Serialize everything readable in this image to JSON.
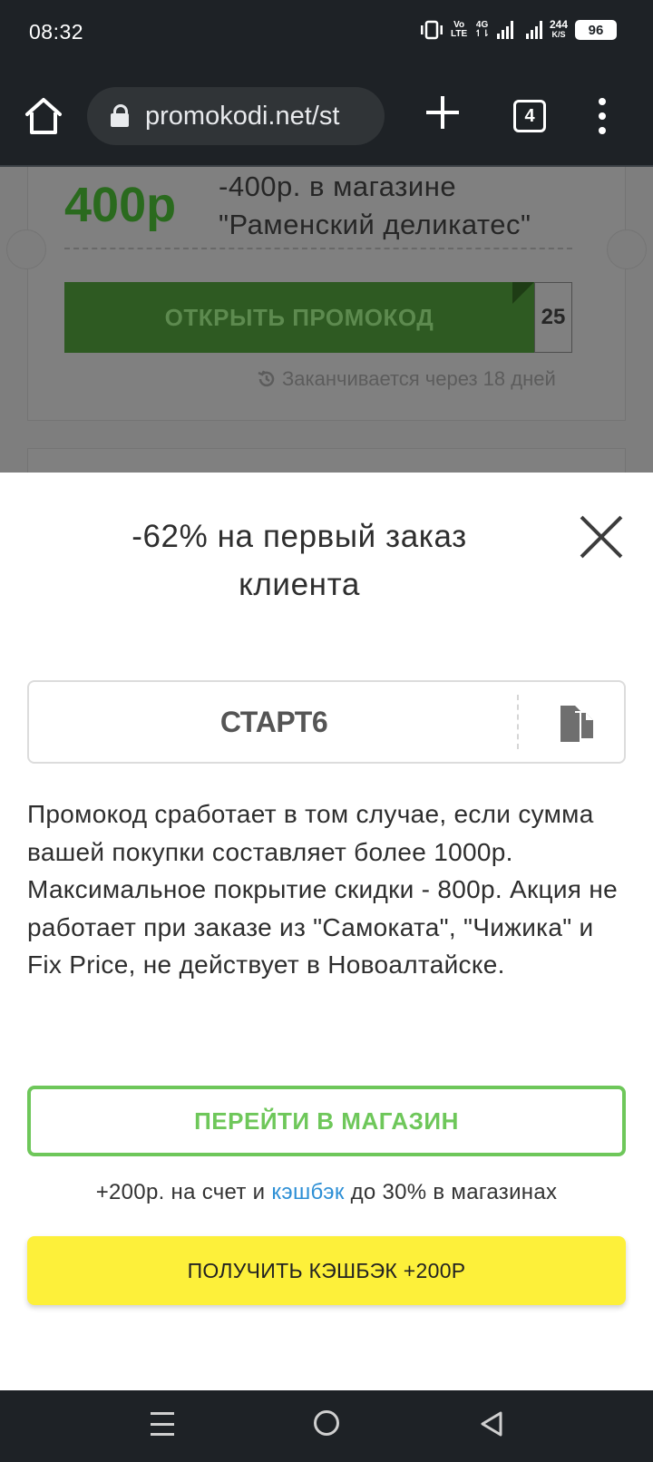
{
  "status_bar": {
    "time": "08:32",
    "network_top": "Vo",
    "network_bottom": "LTE",
    "net_type": "4G",
    "speed_value": "244",
    "speed_unit": "K/S",
    "battery": "96",
    "icons": [
      "vibrate-icon",
      "signal-icon",
      "battery-icon"
    ]
  },
  "browser": {
    "url": "promokodi.net/st",
    "tab_count": "4",
    "icons": [
      "home-icon",
      "lock-icon",
      "new-tab-icon",
      "tabs-icon",
      "overflow-menu-icon"
    ]
  },
  "background_card": {
    "value": "400р",
    "title_line1": "-400р. в магазине",
    "title_line2": "\"Раменский деликатес\"",
    "button_label": "ОТКРЫТЬ ПРОМОКОД",
    "code_peek": "25",
    "expires": "Заканчивается через 18 дней"
  },
  "modal": {
    "title": "-62% на первый заказ клиента",
    "promo_code": "СТАРТ6",
    "description": "Промокод сработает в том случае, если сумма вашей покупки составляет более 1000р. Максимальное покрытие скидки - 800р. Акция не работает при заказе из \"Самоката\", \"Чижика\" и Fix Price, не действует в Новоалтайске.",
    "shop_button": "ПЕРЕЙТИ В МАГАЗИН",
    "cashback_prefix": "+200р. на счет и",
    "cashback_link": "кэшбэк",
    "cashback_suffix": "до 30% в магазинах",
    "cashback_button": "ПОЛУЧИТЬ КЭШБЭК +200Р"
  },
  "colors": {
    "green_accent": "#6ec75a",
    "yellow_button": "#fdf03a",
    "link_blue": "#2d8fd5"
  }
}
